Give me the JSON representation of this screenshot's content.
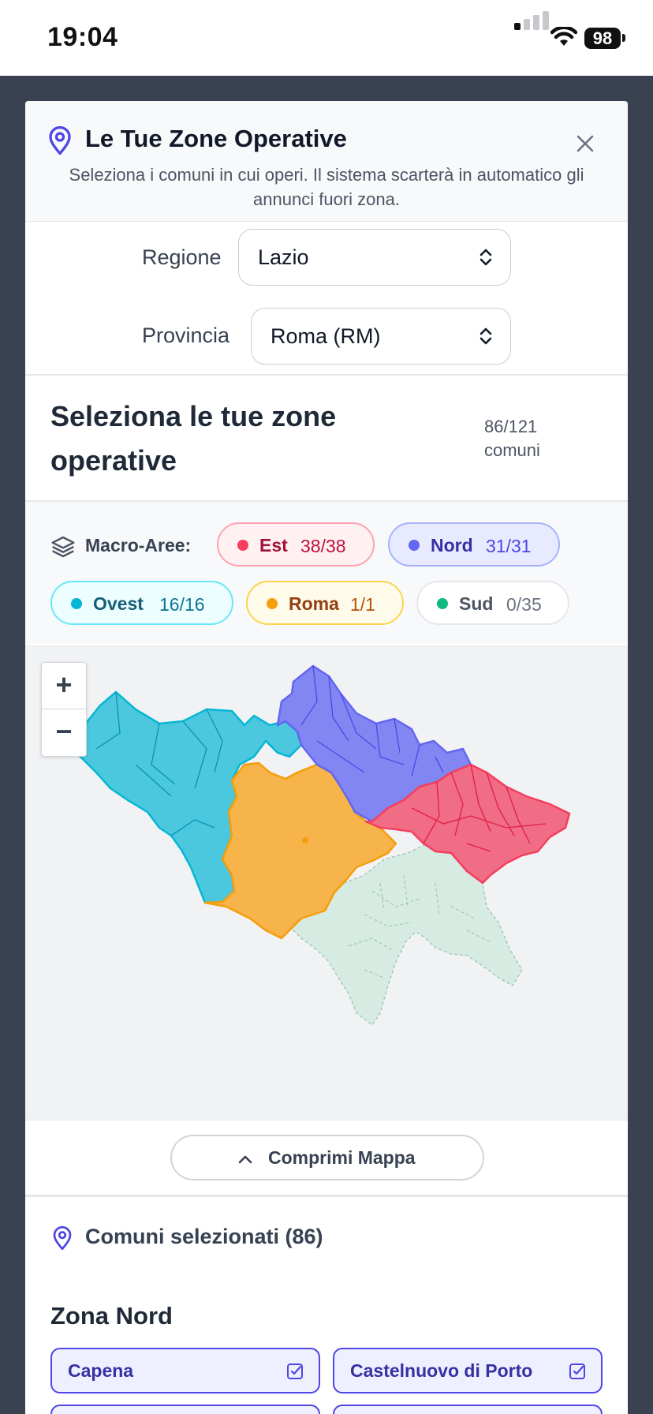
{
  "status_bar": {
    "time": "19:04",
    "battery": "98"
  },
  "modal": {
    "title": "Le Tue Zone Operative",
    "subtitle": "Seleziona i comuni in cui operi. Il sistema scarterà in automatico gli annunci fuori zona.",
    "region_label": "Regione",
    "region_value": "Lazio",
    "province_label": "Provincia",
    "province_value": "Roma (RM)"
  },
  "selection": {
    "title": "Seleziona le tue zone operative",
    "count_line1": "86/121",
    "count_line2": "comuni"
  },
  "macro_areas": {
    "label": "Macro-Aree:",
    "items": [
      {
        "name": "Est",
        "count": "38/38"
      },
      {
        "name": "Nord",
        "count": "31/31"
      },
      {
        "name": "Ovest",
        "count": "16/16"
      },
      {
        "name": "Roma",
        "count": "1/1"
      },
      {
        "name": "Sud",
        "count": "0/35"
      }
    ]
  },
  "map": {
    "zoom_in": "+",
    "zoom_out": "−",
    "collapse_label": "Comprimi Mappa"
  },
  "selected": {
    "title": "Comuni selezionati (86)",
    "zone_title": "Zona Nord",
    "comuni": [
      "Capena",
      "Castelnuovo di Porto"
    ]
  },
  "colors": {
    "est": "#f43f5e",
    "nord": "#6366f1",
    "ovest": "#06b6d4",
    "roma": "#f59e0b",
    "sud": "#10b981",
    "accent": "#4f46e5"
  },
  "icons": [
    "map-pin-icon",
    "close-icon",
    "chevron-updown-icon",
    "layers-icon",
    "chevron-up-icon",
    "checkbox-icon",
    "signal-icon",
    "wifi-icon"
  ]
}
